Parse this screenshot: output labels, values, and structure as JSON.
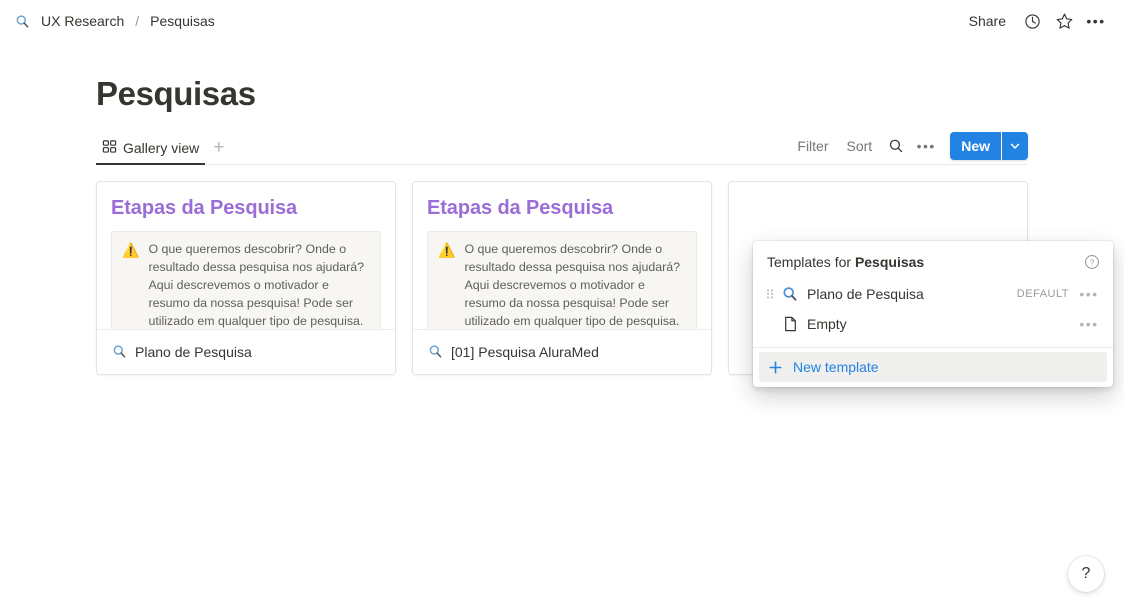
{
  "colors": {
    "accent": "#2383e2",
    "heading_purple": "#9a6dd7",
    "text_default": "#37352f",
    "text_muted": "#787774",
    "callout_bg": "#f7f6f3",
    "panel_hover": "#efefee"
  },
  "topbar": {
    "breadcrumb": {
      "icon": "magnifier-icon",
      "parent": "UX Research",
      "separator": "/",
      "current": "Pesquisas"
    },
    "share_label": "Share",
    "updates_icon": "clock-icon",
    "favorite_icon": "star-icon",
    "more_icon": "more-horizontal-icon"
  },
  "page": {
    "title": "Pesquisas"
  },
  "viewbar": {
    "tabs": [
      {
        "label": "Gallery view",
        "icon": "gallery-grid-icon",
        "active": true
      }
    ],
    "add_view_label": "+",
    "filter_label": "Filter",
    "sort_label": "Sort",
    "search_icon": "search-icon",
    "more_icon": "more-horizontal-icon",
    "new_button_label": "New",
    "new_button_arrow_icon": "chevron-down-icon"
  },
  "gallery": {
    "cards": [
      {
        "heading": "Etapas da Pesquisa",
        "callout_emoji": "⚠️",
        "callout_text": "O que queremos descobrir? Onde o resultado dessa pesquisa nos ajudará? Aqui descrevemos o motivador e resumo da nossa pesquisa! Pode ser utilizado em qualquer tipo de pesquisa.",
        "footer_icon": "magnifier-icon",
        "footer_title": "Plano de Pesquisa"
      },
      {
        "heading": "Etapas da Pesquisa",
        "callout_emoji": "⚠️",
        "callout_text": "O que queremos descobrir? Onde o resultado dessa pesquisa nos ajudará? Aqui descrevemos o motivador e resumo da nossa pesquisa! Pode ser utilizado em qualquer tipo de pesquisa.",
        "footer_icon": "magnifier-icon",
        "footer_title": "[01] Pesquisa AluraMed"
      },
      {
        "heading": "",
        "callout_emoji": "",
        "callout_text": "",
        "footer_icon": "",
        "footer_title": ""
      }
    ]
  },
  "templates_panel": {
    "header_prefix": "Templates for ",
    "header_database": "Pesquisas",
    "help_icon": "question-circle-icon",
    "items": [
      {
        "grip_icon": "drag-handle-icon",
        "icon": "magnifier-icon",
        "label": "Plano de Pesquisa",
        "badge": "DEFAULT",
        "more_icon": "more-horizontal-icon"
      },
      {
        "grip_icon": "",
        "icon": "page-icon",
        "label": "Empty",
        "badge": "",
        "more_icon": "more-horizontal-icon"
      }
    ],
    "new_template": {
      "icon": "plus-icon",
      "label": "New template"
    }
  },
  "help_fab": {
    "label": "?",
    "icon": "question-mark-icon"
  }
}
